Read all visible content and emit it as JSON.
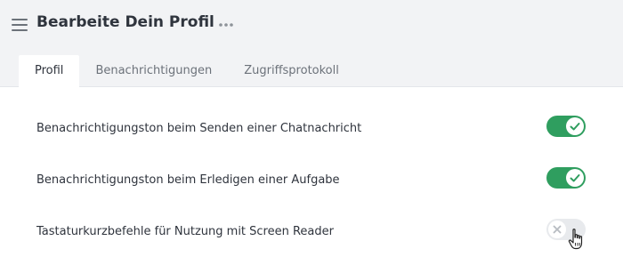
{
  "header": {
    "title": "Bearbeite Dein Profil",
    "menu_icon": "hamburger-menu-icon",
    "more_icon": "kebab-horizontal-icon"
  },
  "tabs": [
    {
      "label": "Profil",
      "active": true
    },
    {
      "label": "Benachrichtigungen",
      "active": false
    },
    {
      "label": "Zugriffsprotokoll",
      "active": false
    }
  ],
  "settings": [
    {
      "label": "Benachrichtigungston beim Senden einer Chatnachricht",
      "enabled": true
    },
    {
      "label": "Benachrichtigungston beim Erledigen einer Aufgabe",
      "enabled": true
    },
    {
      "label": "Tastaturkurzbefehle für Nutzung mit Screen Reader",
      "enabled": false
    }
  ],
  "colors": {
    "toggle_on": "#2f9e5f",
    "toggle_off": "#e8eaed",
    "header_bg": "#f2f3f5"
  }
}
